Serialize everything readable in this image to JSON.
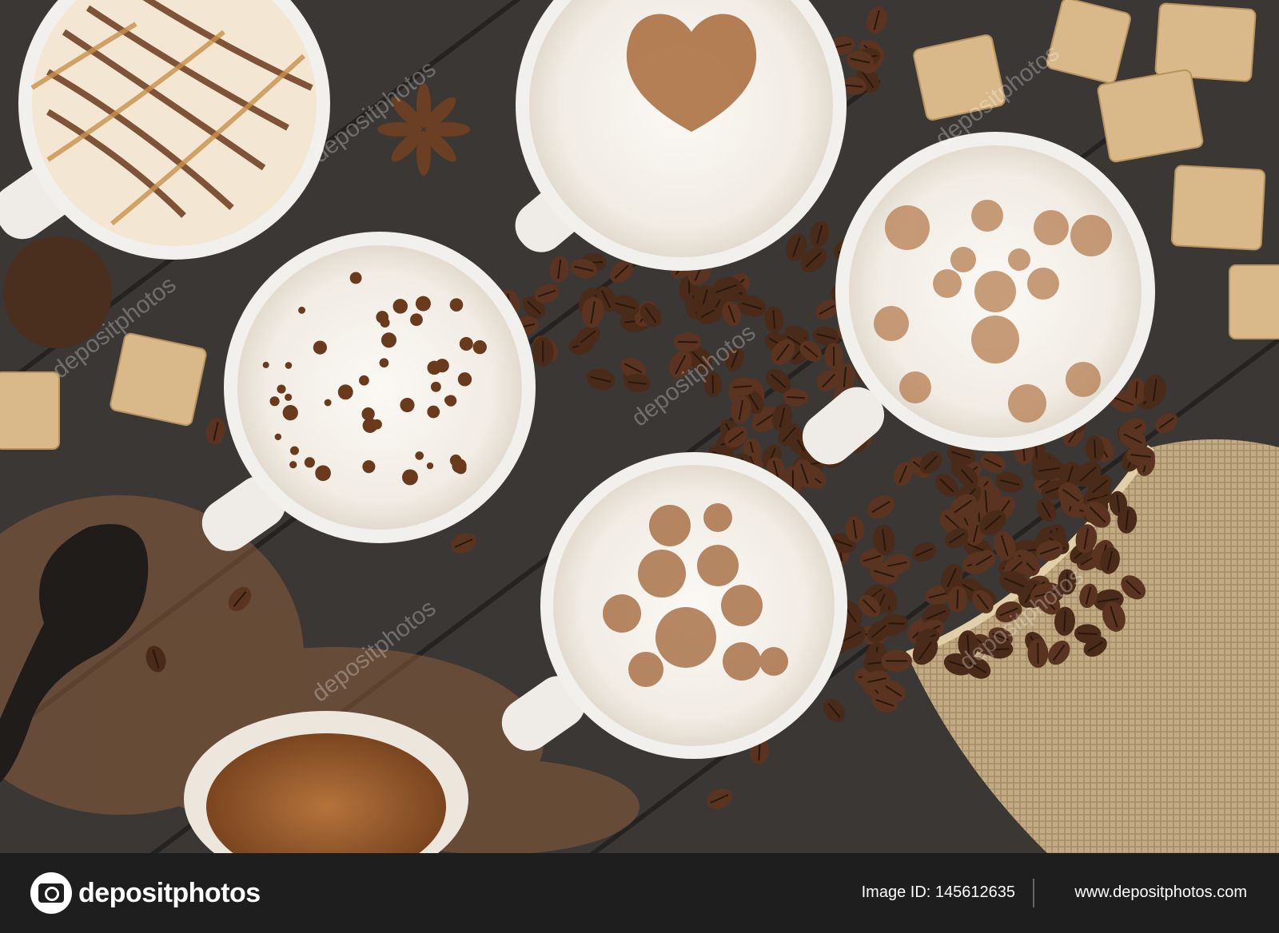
{
  "photo": {
    "subject": "coffee-cups-flatlay",
    "watermark": "depositphotos",
    "colors": {
      "table": "#3a3735",
      "plank_line": "#2a2826",
      "cup": "#f2f0ec",
      "foam": "#f7f4ef",
      "cinnamon": "#a86a3a",
      "caramel": "#c9924a",
      "bean": "#5a3420",
      "sugar": "#d9b98a",
      "burlap": "#c2ab84"
    }
  },
  "footer": {
    "brand_name": "depositphotos",
    "image_id": "Image ID: 145612635",
    "site_url": "www.depositphotos.com"
  }
}
